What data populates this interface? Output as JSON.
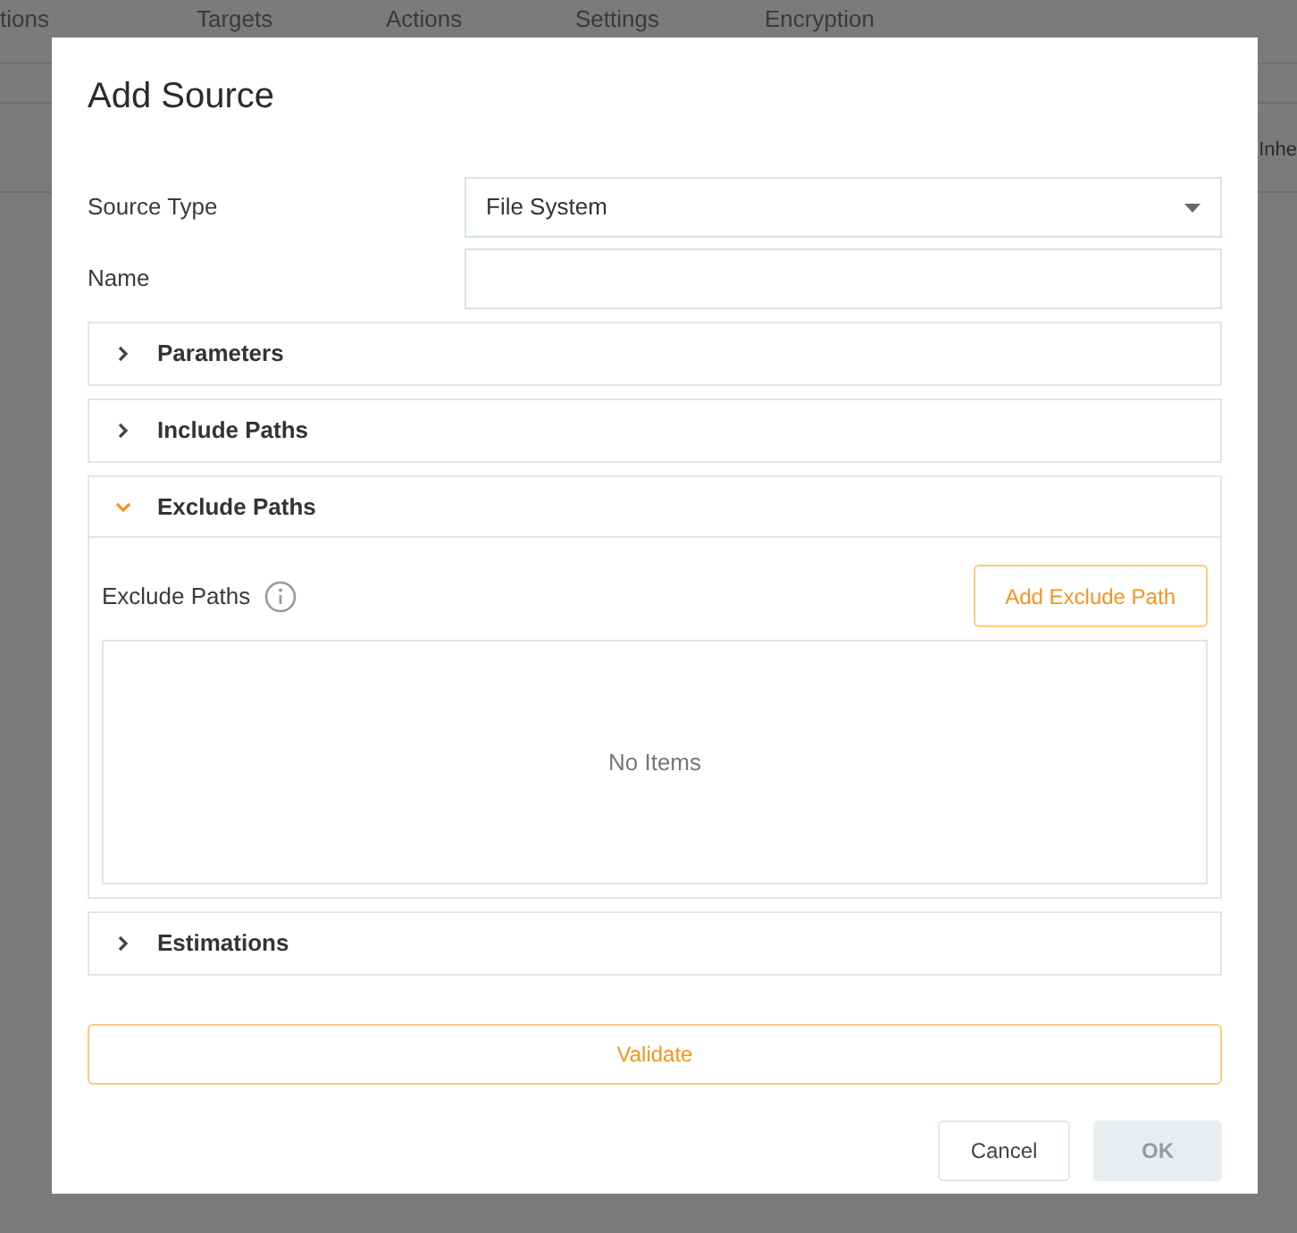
{
  "background": {
    "tabs": [
      {
        "label": "tions"
      },
      {
        "label": "Targets"
      },
      {
        "label": "Actions"
      },
      {
        "label": "Settings"
      },
      {
        "label": "Encryption"
      }
    ],
    "column_header": "Inhe"
  },
  "dialog": {
    "title": "Add Source",
    "fields": [
      {
        "kind": "select",
        "label": "Source Type",
        "value": "File System"
      },
      {
        "kind": "text",
        "label": "Name"
      }
    ],
    "sections": [
      {
        "title": "Parameters",
        "expanded": false
      },
      {
        "title": "Include Paths",
        "expanded": false
      },
      {
        "title": "Exclude Paths",
        "expanded": true,
        "content": {
          "label": "Exclude Paths",
          "button": "Add Exclude Path",
          "empty_text": "No Items"
        }
      },
      {
        "title": "Estimations",
        "expanded": false
      }
    ],
    "validate_button": "Validate",
    "buttons": [
      {
        "label": "Cancel",
        "disabled": false
      },
      {
        "label": "OK",
        "disabled": true
      }
    ]
  }
}
